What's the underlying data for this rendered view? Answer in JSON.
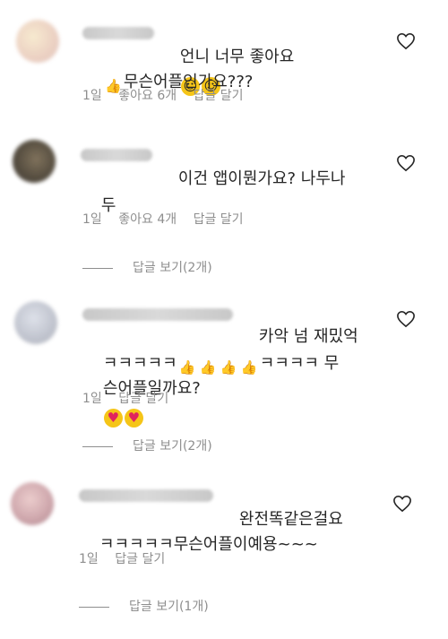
{
  "comments": [
    {
      "text_line1_prefix": "언니 너무 좋아요",
      "text_line2_suffix": "무슨어플인가요???",
      "time": "1일",
      "likes": "좋아요 6개",
      "reply": "답글 달기"
    },
    {
      "text_line1": "이건 앱이뭔가요? 나두나",
      "text_line2": "두",
      "time": "1일",
      "likes": "좋아요 4개",
      "reply": "답글 달기",
      "view_replies": "답글 보기(2개)"
    },
    {
      "text_line1": "카악 넘 재밌억",
      "text_line2_prefix": "ㅋㅋㅋㅋㅋ",
      "text_line2_suffix": "ㅋㅋㅋㅋ 무",
      "text_line3_prefix": "슨어플일까요?",
      "time": "1일",
      "reply": "답글 달기",
      "view_replies": "답글 보기(2개)"
    },
    {
      "text_line1": "완전똑같은걸요",
      "text_line2": "ㅋㅋㅋㅋㅋ무슨어플이예용~~~",
      "time": "1일",
      "reply": "답글 달기",
      "view_replies": "답글 보기(1개)"
    }
  ],
  "icons": {
    "heart": "heart-outline-icon",
    "smile": "smiling-face-emoji",
    "thumbs_up": "thumbs-up-emoji",
    "heart_eyes": "heart-eyes-emoji"
  }
}
